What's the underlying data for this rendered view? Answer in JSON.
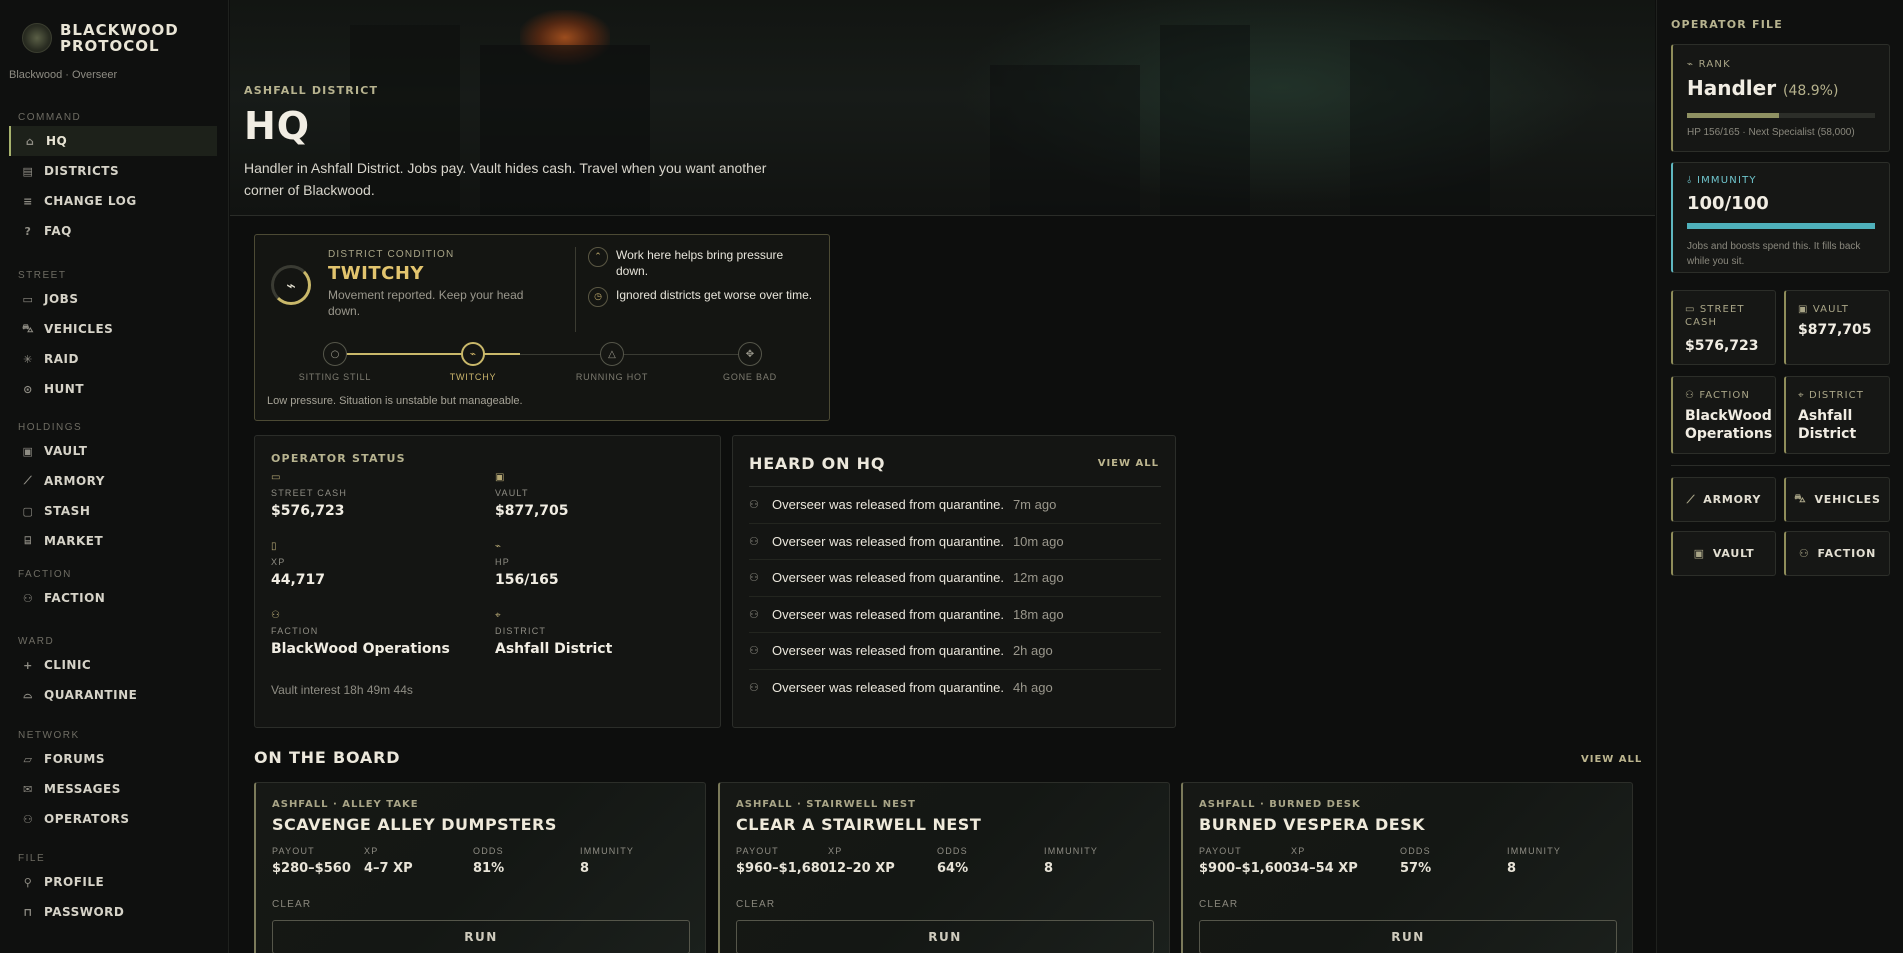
{
  "brand": {
    "name_line1": "BLACKWOOD",
    "name_line2": "PROTOCOL",
    "subtitle": "Blackwood · Overseer"
  },
  "sidebar": {
    "groups": [
      {
        "heading": "COMMAND",
        "items": [
          {
            "label": "HQ",
            "icon": "home-icon",
            "active": true
          },
          {
            "label": "DISTRICTS",
            "icon": "map-icon"
          },
          {
            "label": "CHANGE LOG",
            "icon": "list-icon"
          },
          {
            "label": "FAQ",
            "icon": "question-icon"
          }
        ]
      },
      {
        "heading": "STREET",
        "items": [
          {
            "label": "JOBS",
            "icon": "briefcase-icon"
          },
          {
            "label": "VEHICLES",
            "icon": "car-icon"
          },
          {
            "label": "RAID",
            "icon": "burst-icon"
          },
          {
            "label": "HUNT",
            "icon": "crosshair-icon"
          }
        ]
      },
      {
        "heading": "HOLDINGS",
        "items": [
          {
            "label": "VAULT",
            "icon": "vault-icon"
          },
          {
            "label": "ARMORY",
            "icon": "weapon-icon"
          },
          {
            "label": "STASH",
            "icon": "box-icon"
          },
          {
            "label": "MARKET",
            "icon": "store-icon"
          }
        ]
      },
      {
        "heading": "FACTION",
        "items": [
          {
            "label": "FACTION",
            "icon": "users-icon"
          }
        ]
      },
      {
        "heading": "WARD",
        "items": [
          {
            "label": "CLINIC",
            "icon": "plus-icon"
          },
          {
            "label": "QUARANTINE",
            "icon": "bell-icon"
          }
        ]
      },
      {
        "heading": "NETWORK",
        "items": [
          {
            "label": "FORUMS",
            "icon": "chat-icon"
          },
          {
            "label": "MESSAGES",
            "icon": "mail-icon"
          },
          {
            "label": "OPERATORS",
            "icon": "users-icon"
          }
        ]
      },
      {
        "heading": "FILE",
        "items": [
          {
            "label": "PROFILE",
            "icon": "user-icon"
          },
          {
            "label": "PASSWORD",
            "icon": "lock-icon"
          }
        ]
      }
    ]
  },
  "hero": {
    "kicker": "ASHFALL DISTRICT",
    "title": "HQ",
    "description": "Handler in Ashfall District. Jobs pay. Vault hides cash. Travel when you want another corner of Blackwood."
  },
  "condition": {
    "label": "DISTRICT CONDITION",
    "value": "TWITCHY",
    "description": "Movement reported. Keep your head down.",
    "notes": [
      "Work here helps bring pressure down.",
      "Ignored districts get worse over time."
    ],
    "stages": [
      "SITTING STILL",
      "TWITCHY",
      "RUNNING HOT",
      "GONE BAD"
    ],
    "active_stage": 1,
    "footer": "Low pressure. Situation is unstable but manageable."
  },
  "operator_status": {
    "title": "OPERATOR STATUS",
    "cells": [
      {
        "key": "STREET CASH",
        "value": "$576,723",
        "icon": "cash-icon"
      },
      {
        "key": "VAULT",
        "value": "$877,705",
        "icon": "vault-icon"
      },
      {
        "key": "XP",
        "value": "44,717",
        "icon": "file-icon"
      },
      {
        "key": "HP",
        "value": "156/165",
        "icon": "pulse-icon"
      },
      {
        "key": "FACTION",
        "value": "BlackWood Operations",
        "icon": "users-icon"
      },
      {
        "key": "DISTRICT",
        "value": "Ashfall District",
        "icon": "pin-icon"
      }
    ],
    "footer": "Vault interest 18h 49m 44s"
  },
  "heard": {
    "title": "HEARD ON HQ",
    "view_all": "VIEW ALL",
    "items": [
      {
        "text": "Overseer was released from quarantine.",
        "time": "7m ago"
      },
      {
        "text": "Overseer was released from quarantine.",
        "time": "10m ago"
      },
      {
        "text": "Overseer was released from quarantine.",
        "time": "12m ago"
      },
      {
        "text": "Overseer was released from quarantine.",
        "time": "18m ago"
      },
      {
        "text": "Overseer was released from quarantine.",
        "time": "2h ago"
      },
      {
        "text": "Overseer was released from quarantine.",
        "time": "4h ago"
      }
    ]
  },
  "board": {
    "title": "ON THE BOARD",
    "view_all": "VIEW ALL",
    "jobs": [
      {
        "tag": "ASHFALL · ALLEY TAKE",
        "name": "SCAVENGE ALLEY DUMPSTERS",
        "payout": "$280–$560",
        "xp": "4–7 XP",
        "odds": "81%",
        "immunity": "8",
        "status": "CLEAR",
        "action": "RUN"
      },
      {
        "tag": "ASHFALL · STAIRWELL NEST",
        "name": "CLEAR A STAIRWELL NEST",
        "payout": "$960–$1,680",
        "xp": "12–20 XP",
        "odds": "64%",
        "immunity": "8",
        "status": "CLEAR",
        "action": "RUN"
      },
      {
        "tag": "ASHFALL · BURNED DESK",
        "name": "BURNED VESPERA DESK",
        "payout": "$900–$1,600",
        "xp": "34–54 XP",
        "odds": "57%",
        "immunity": "8",
        "status": "CLEAR",
        "action": "RUN"
      }
    ],
    "stat_labels": {
      "payout": "PAYOUT",
      "xp": "XP",
      "odds": "ODDS",
      "immunity": "IMMUNITY"
    }
  },
  "operator_file": {
    "heading": "OPERATOR FILE",
    "rank": {
      "label": "RANK",
      "value": "Handler",
      "percent_text": "(48.9%)",
      "progress": 0.489,
      "sub": "HP 156/165 · Next Specialist (58,000)"
    },
    "immunity": {
      "label": "IMMUNITY",
      "value": "100/100",
      "progress": 1.0,
      "sub": "Jobs and boosts spend this. It fills back while you sit."
    },
    "street_cash": {
      "label": "STREET CASH",
      "value": "$576,723"
    },
    "vault": {
      "label": "VAULT",
      "value": "$877,705"
    },
    "faction": {
      "label": "FACTION",
      "value": "BlackWood Operations"
    },
    "district": {
      "label": "DISTRICT",
      "value": "Ashfall District"
    },
    "quick_links": [
      "ARMORY",
      "VEHICLES",
      "VAULT",
      "FACTION"
    ]
  },
  "colors": {
    "accent": "#c9b86a",
    "immunity": "#4fb1bb",
    "background": "#0d0e0d"
  }
}
